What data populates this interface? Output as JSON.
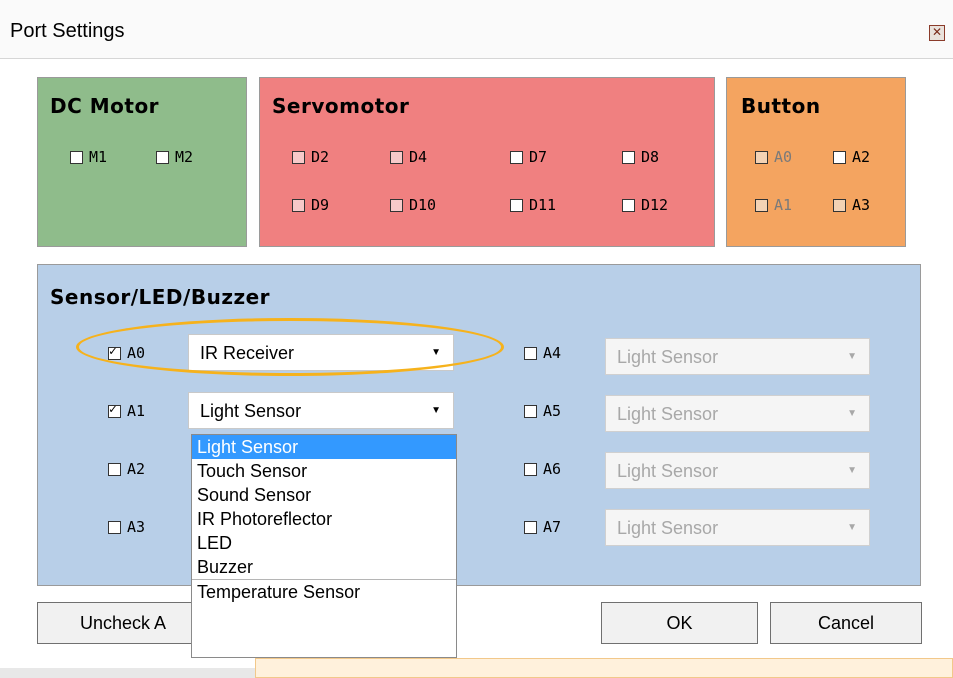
{
  "window": {
    "title": "Port Settings"
  },
  "dc_motor": {
    "title": "DC Motor",
    "ports": [
      "M1",
      "M2"
    ]
  },
  "servomotor": {
    "title": "Servomotor",
    "ports": [
      "D2",
      "D4",
      "D7",
      "D8",
      "D9",
      "D10",
      "D11",
      "D12"
    ]
  },
  "button": {
    "title": "Button",
    "ports": [
      "A0",
      "A2",
      "A1",
      "A3"
    ]
  },
  "sensor": {
    "title": "Sensor/LED/Buzzer",
    "rows": [
      {
        "port": "A0",
        "checked": true,
        "value": "IR Receiver"
      },
      {
        "port": "A1",
        "checked": true,
        "value": "Light Sensor"
      },
      {
        "port": "A2",
        "checked": false,
        "value": ""
      },
      {
        "port": "A3",
        "checked": false,
        "value": ""
      },
      {
        "port": "A4",
        "checked": false,
        "value": "Light Sensor"
      },
      {
        "port": "A5",
        "checked": false,
        "value": "Light Sensor"
      },
      {
        "port": "A6",
        "checked": false,
        "value": "Light Sensor"
      },
      {
        "port": "A7",
        "checked": false,
        "value": "Light Sensor"
      }
    ],
    "dropdown_options": [
      "Light Sensor",
      "Touch Sensor",
      "Sound Sensor",
      "IR Photoreflector",
      "LED",
      "Buzzer",
      "Temperature Sensor"
    ]
  },
  "buttons": {
    "uncheck": "Uncheck A",
    "ok": "OK",
    "cancel": "Cancel"
  },
  "colors": {
    "dc_motor_bg": "#8fbc8b",
    "servo_bg": "#f08080",
    "button_bg": "#f4a460",
    "sensor_bg": "#b8cfe8",
    "highlight": "#f6b21c",
    "selection": "#3399ff"
  }
}
